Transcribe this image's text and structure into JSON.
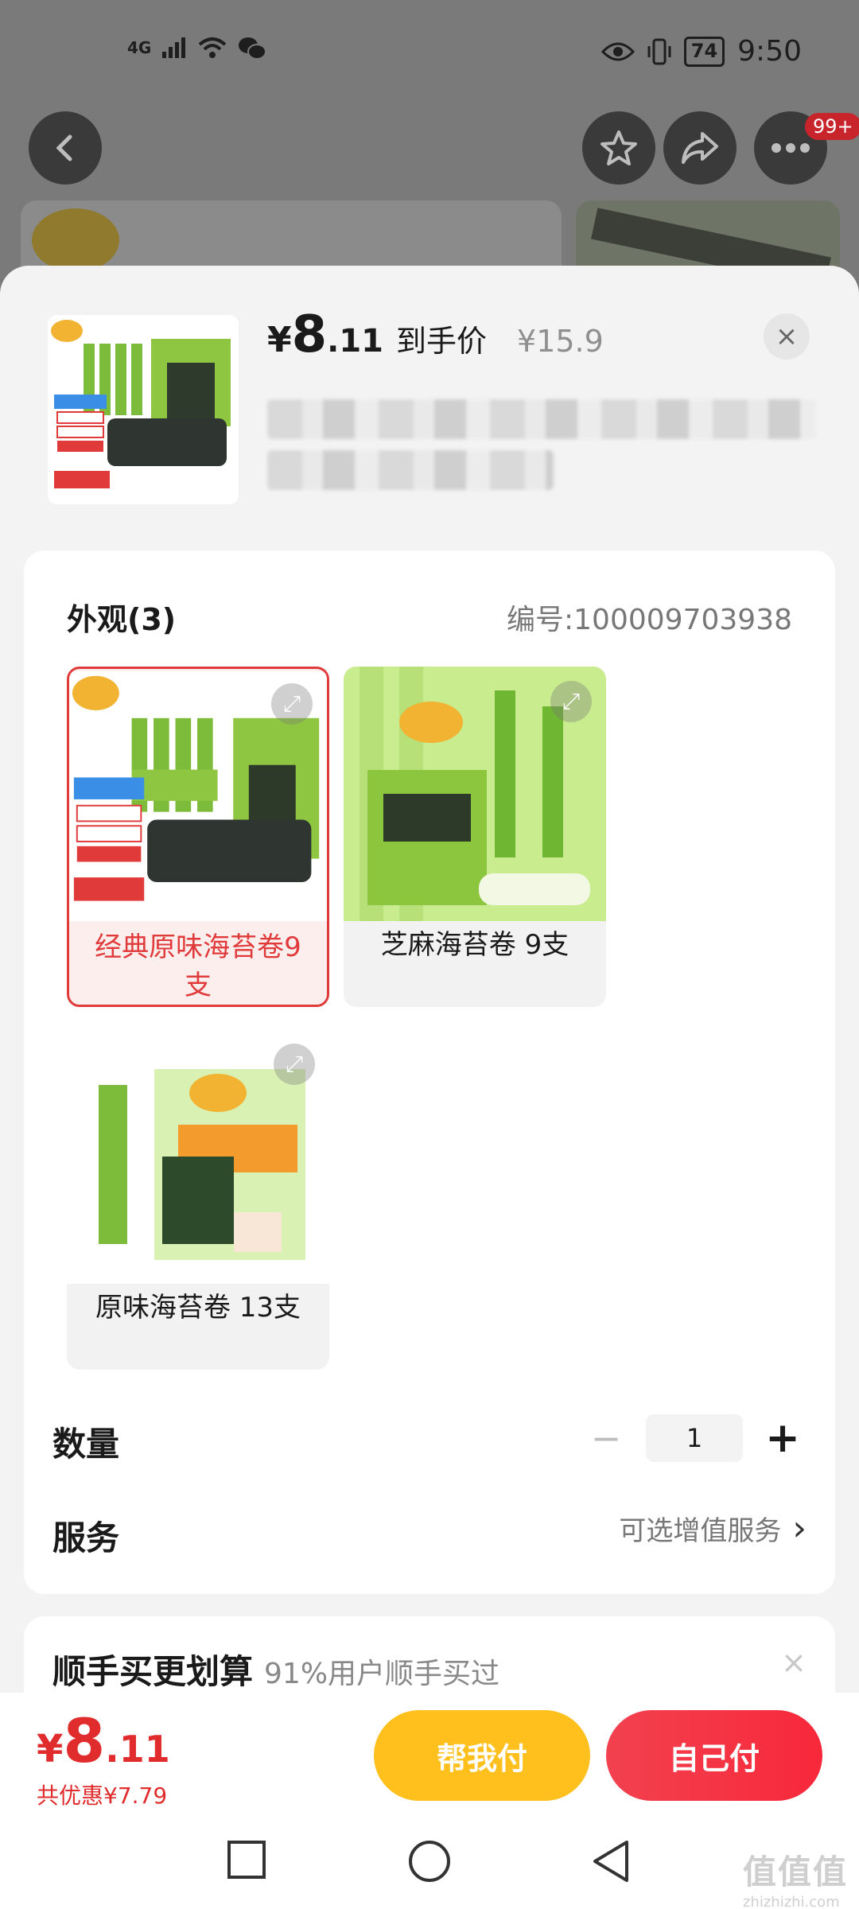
{
  "status_bar": {
    "network": "4G",
    "battery": "74",
    "time": "9:50"
  },
  "top_nav": {
    "notification_badge": "99+"
  },
  "product": {
    "price_currency": "¥",
    "price_integer": "8",
    "price_decimal": ".11",
    "price_tag": "到手价",
    "original_price": "¥15.9",
    "close_label": "×"
  },
  "appearance": {
    "title": "外观(3)",
    "sku_number": "编号:100009703938",
    "variants": [
      {
        "label": "经典原味海苔卷9支",
        "selected": true
      },
      {
        "label": "芝麻海苔卷 9支",
        "selected": false
      },
      {
        "label": "原味海苔卷 13支",
        "selected": false
      }
    ]
  },
  "quantity": {
    "label": "数量",
    "value": "1",
    "minus": "−",
    "plus": "+"
  },
  "service": {
    "label": "服务",
    "value": "可选增值服务",
    "chevron": "›"
  },
  "bundle": {
    "title": "顺手买更划算",
    "subtitle": "91%用户顺手买过",
    "close": "×"
  },
  "checkout": {
    "total_currency": "¥",
    "total_integer": "8",
    "total_decimal": ".11",
    "discount": "共优惠¥7.79",
    "help_pay_label": "帮我付",
    "self_pay_label": "自己付"
  },
  "watermark": {
    "text": "值值值",
    "domain": "zhizhizhi.com"
  },
  "colors": {
    "accent_red": "#e02c2c",
    "help_yellow": "#ffc01e",
    "pay_red": "#f2414f"
  }
}
